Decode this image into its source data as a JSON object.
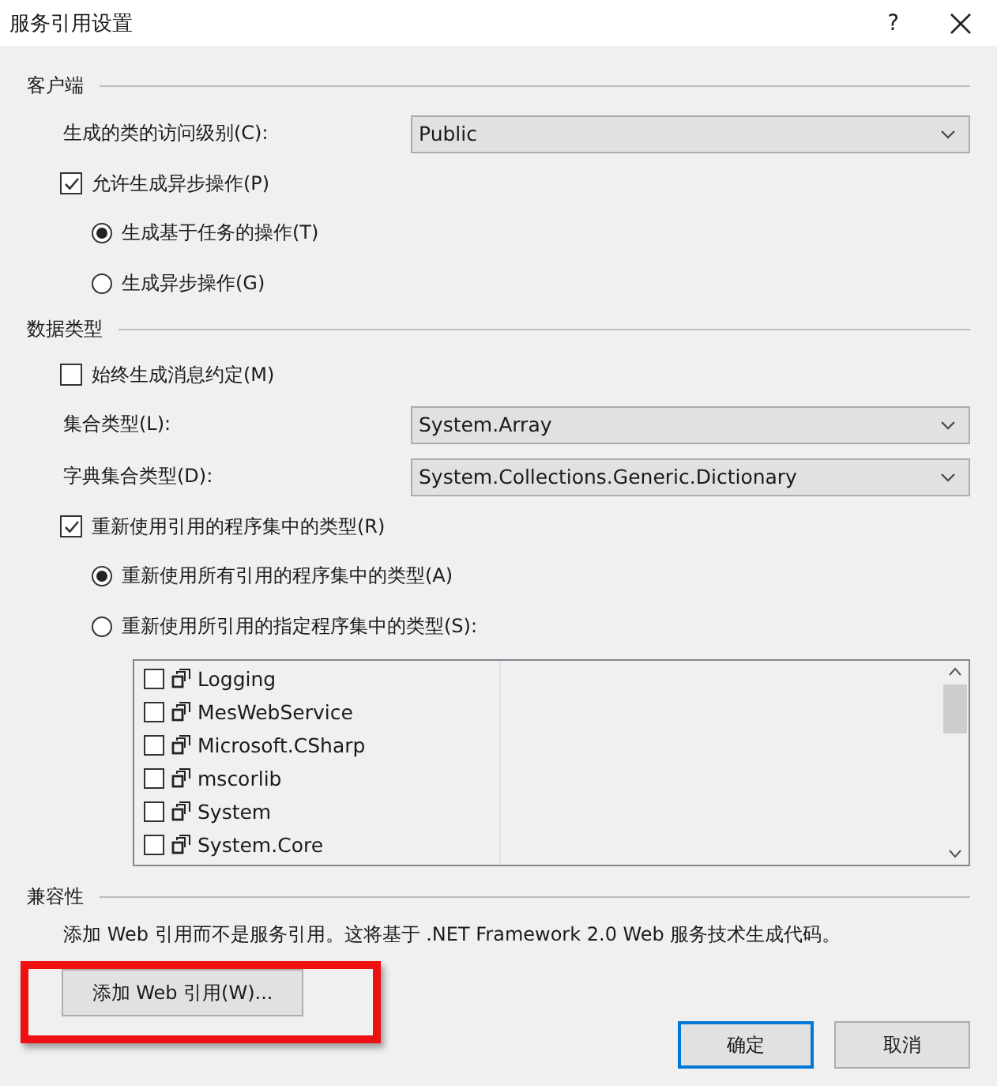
{
  "window": {
    "title": "服务引用设置",
    "help": "?"
  },
  "sections": [
    {
      "heading": "客户端",
      "items": [
        {
          "kind": "combo",
          "label": "生成的类的访问级别(C):",
          "value": "Public"
        },
        {
          "kind": "checkbox",
          "label": "允许生成异步操作(P)",
          "checked": true
        },
        {
          "kind": "radio",
          "label": "生成基于任务的操作(T)",
          "selected": true
        },
        {
          "kind": "radio",
          "label": "生成异步操作(G)",
          "selected": false
        }
      ]
    },
    {
      "heading": "数据类型",
      "items": [
        {
          "kind": "checkbox",
          "label": "始终生成消息约定(M)",
          "checked": false
        },
        {
          "kind": "combo",
          "label": "集合类型(L):",
          "value": "System.Array"
        },
        {
          "kind": "combo",
          "label": "字典集合类型(D):",
          "value": "System.Collections.Generic.Dictionary"
        },
        {
          "kind": "checkbox",
          "label": "重新使用引用的程序集中的类型(R)",
          "checked": true
        },
        {
          "kind": "radio",
          "label": "重新使用所有引用的程序集中的类型(A)",
          "selected": true
        },
        {
          "kind": "radio",
          "label": "重新使用所引用的指定程序集中的类型(S):",
          "selected": false
        },
        {
          "kind": "list",
          "entries": [
            {
              "name": "Logging",
              "checked": false
            },
            {
              "name": "MesWebService",
              "checked": false
            },
            {
              "name": "Microsoft.CSharp",
              "checked": false
            },
            {
              "name": "mscorlib",
              "checked": false
            },
            {
              "name": "System",
              "checked": false
            },
            {
              "name": "System.Core",
              "checked": false
            }
          ]
        }
      ]
    },
    {
      "heading": "兼容性",
      "items": [
        {
          "kind": "note",
          "text": "添加 Web 引用而不是服务引用。这将基于 .NET Framework 2.0 Web 服务技术生成代码。"
        },
        {
          "kind": "button",
          "label": "添加 Web 引用(W)...",
          "highlighted": true
        }
      ]
    }
  ],
  "buttons": [
    {
      "label": "确定",
      "selected": true
    },
    {
      "label": "取消",
      "selected": false
    }
  ]
}
